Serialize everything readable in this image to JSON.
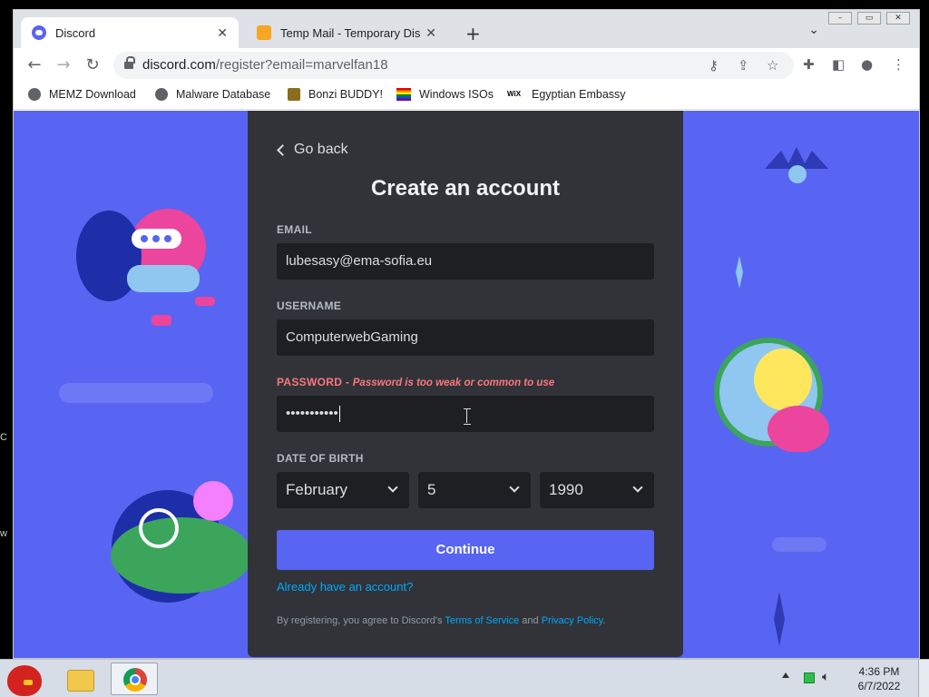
{
  "browser": {
    "tabs": [
      {
        "label": "Discord",
        "close": "✕"
      },
      {
        "label": "Temp Mail - Temporary Dispo",
        "close": "✕"
      }
    ],
    "new_tab": "+",
    "tab_menu": "⌄",
    "url_host": "discord.com",
    "url_path": "/register?email=marvelfan18",
    "bookmarks": [
      "MEMZ Download",
      "Malware Database",
      "Bonzi BUDDY!",
      "Windows ISOs",
      "Egyptian Embassy"
    ],
    "window_controls": [
      "–",
      "▭",
      "✕"
    ]
  },
  "form": {
    "back_label": "Go back",
    "title": "Create an account",
    "email_label": "EMAIL",
    "email_value": "lubesasy@ema-sofia.eu",
    "username_label": "USERNAME",
    "username_value": "ComputerwebGaming",
    "password_label": "PASSWORD",
    "password_separator": " - ",
    "password_error": "Password is too weak or common to use",
    "password_value": "•••••••••••",
    "dob_label": "DATE OF BIRTH",
    "dob_month": "February",
    "dob_day": "5",
    "dob_year": "1990",
    "continue_label": "Continue",
    "already_label": "Already have an account?",
    "terms_prefix": "By registering, you agree to Discord's ",
    "terms_link": "Terms of Service",
    "terms_and": " and ",
    "privacy_link": "Privacy Policy",
    "terms_suffix": "."
  },
  "taskbar": {
    "time": "4:36 PM",
    "date": "6/7/2022"
  },
  "colors": {
    "blurple": "#5865f2",
    "card": "#313338",
    "input": "#1e1f22",
    "error": "#fa777c",
    "link": "#00a8fc"
  }
}
